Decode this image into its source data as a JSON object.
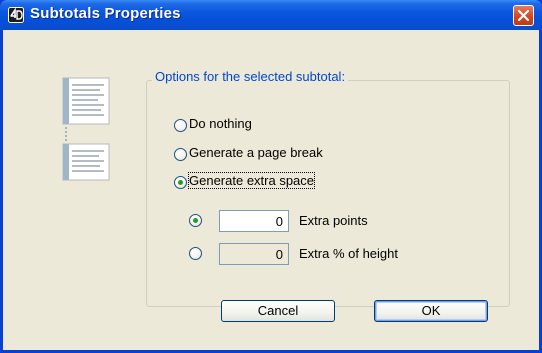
{
  "window": {
    "title": "Subtotals Properties"
  },
  "group": {
    "title": "Options for the selected subtotal:"
  },
  "options": [
    {
      "label": "Do nothing",
      "selected": false
    },
    {
      "label": "Generate a page break",
      "selected": false
    },
    {
      "label": "Generate extra space",
      "selected": true
    }
  ],
  "extra_space": [
    {
      "value": "0",
      "label": "Extra points",
      "selected": true,
      "enabled": true
    },
    {
      "value": "0",
      "label": "Extra % of height",
      "selected": false,
      "enabled": false
    }
  ],
  "buttons": {
    "cancel": "Cancel",
    "ok": "OK"
  },
  "colors": {
    "titlebar": "#0650d8",
    "dialog_bg": "#ece9d8",
    "group_title": "#0046d5",
    "radio_dot": "#21a121",
    "close_button": "#d2431e"
  },
  "icons": {
    "app": "4d-app-icon",
    "close": "close-icon",
    "subtotal": "subtotal-document-icon"
  }
}
